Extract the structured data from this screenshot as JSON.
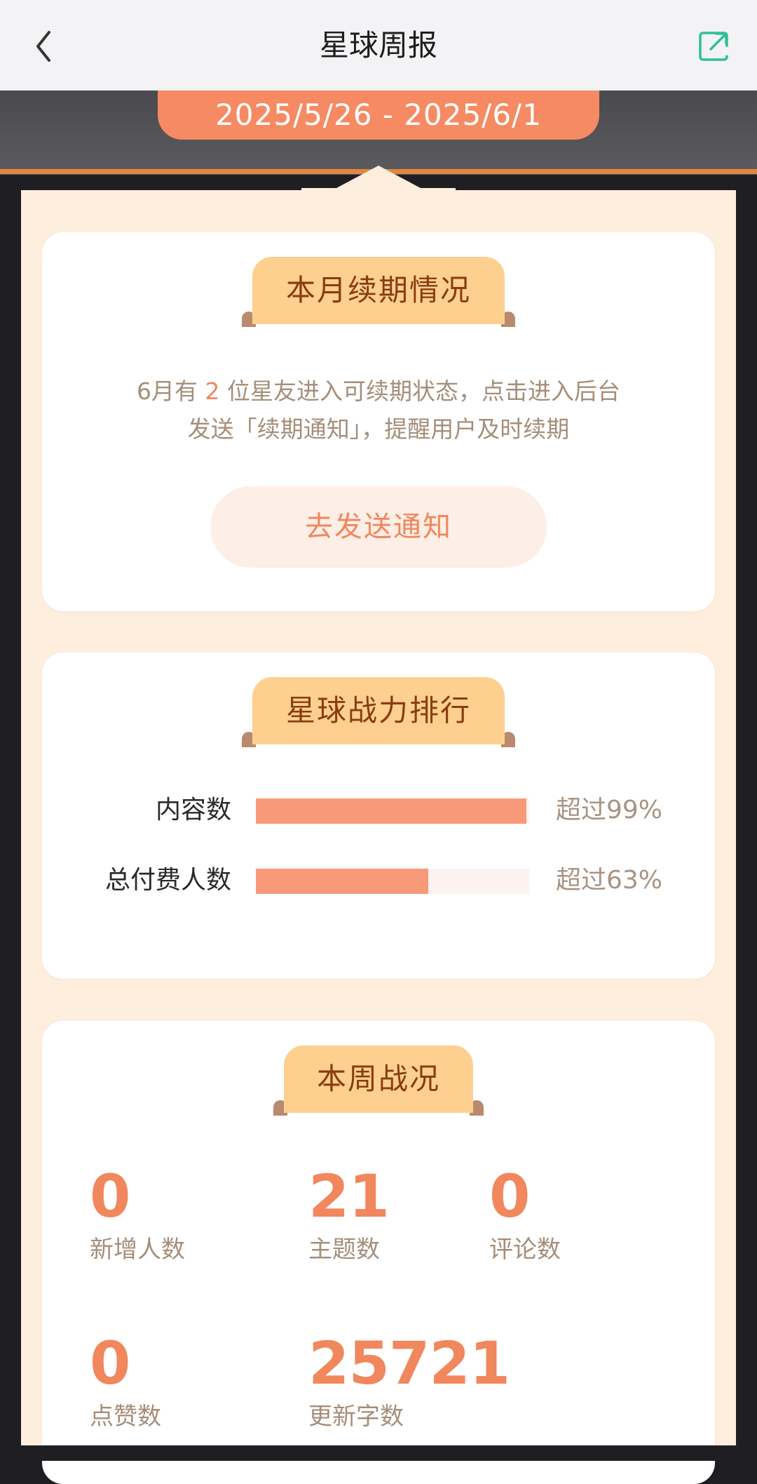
{
  "nav": {
    "title": "星球周报",
    "back_icon": "chevron-left-icon",
    "share_icon": "external-share-icon",
    "accent": "#2fbf9a"
  },
  "date_range": "2025/5/26 - 2025/6/1",
  "renewal": {
    "tab": "本月续期情况",
    "text_pre": "6月有 ",
    "count": "2",
    "text_post": " 位星友进入可续期状态，点击进入后台",
    "text_line2": "发送「续期通知」，提醒用户及时续期",
    "button": "去发送通知"
  },
  "ranking": {
    "tab": "星球战力排行",
    "rows": [
      {
        "label": "内容数",
        "percent": 99,
        "text": "超过99%"
      },
      {
        "label": "总付费人数",
        "percent": 63,
        "text": "超过63%"
      }
    ]
  },
  "weekly": {
    "tab": "本周战况",
    "stats": [
      {
        "value": "0",
        "label": "新增人数"
      },
      {
        "value": "21",
        "label": "主题数"
      },
      {
        "value": "0",
        "label": "评论数"
      },
      {
        "value": "0",
        "label": "点赞数"
      },
      {
        "value": "25721",
        "label": "更新字数"
      }
    ]
  },
  "colors": {
    "accent_orange": "#f0875d",
    "pill": "#f58a63",
    "tab_bg": "#fdd08f",
    "bar_fill": "#f89a79",
    "frame_cream": "#fdeedd"
  }
}
